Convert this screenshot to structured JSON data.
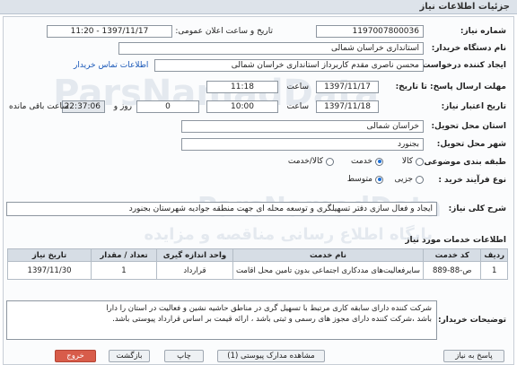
{
  "page_title": "جزئیات اطلاعات نیاز",
  "fields": {
    "need_number_label": "شماره نیاز:",
    "need_number": "1197007800036",
    "announce_label": "تاریخ و ساعت اعلان عمومی:",
    "announce_value": "1397/11/17 - 11:20",
    "buyer_label": "نام دستگاه خریدار:",
    "buyer_value": "استانداری خراسان شمالی",
    "creator_label": "ایجاد کننده درخواست:",
    "creator_value": "محسن ناصری مقدم کاربرداز استانداری خراسان شمالی",
    "contact_link": "اطلاعات تماس خریدار",
    "send_deadline_label": "مهلت ارسال پاسخ: تا تاریخ:",
    "send_date": "1397/11/17",
    "time_label": "ساعت",
    "send_time": "11:18",
    "validity_label": "تاریخ اعتبار نیاز:",
    "validity_date": "1397/11/18",
    "validity_time": "10:00",
    "days_value": "0",
    "days_label": "روز و",
    "remaining_time": "22:37:06",
    "remaining_label": "ساعت باقی مانده",
    "province_label": "استان محل تحویل:",
    "province_value": "خراسان شمالی",
    "city_label": "شهر محل تحویل:",
    "city_value": "بجنورد",
    "category_label": "طبقه بندی موضوعی:",
    "category_options": [
      "کالا",
      "خدمت",
      "کالا/خدمت"
    ],
    "category_selected": "خدمت",
    "process_label": "نوع فرآیند خرید :",
    "process_options": [
      "جزیی",
      "متوسط"
    ],
    "process_selected": "متوسط",
    "description_label": "شرح کلی نیاز:",
    "description_value": "ایجاد و فعال سازی دفتر تسهیلگری و توسعه محله ای جهت منطقه جوادیه شهرستان بجنورد"
  },
  "services_title": "اطلاعات خدمات مورد نیاز",
  "table": {
    "headers": [
      "ردیف",
      "کد خدمت",
      "نام خدمت",
      "واحد اندازه گیری",
      "تعداد / مقدار",
      "تاریخ نیاز"
    ],
    "rows": [
      [
        "1",
        "ص-88-889",
        "سایرفعالیت‌های مددکاری اجتماعی بدون تامین محل اقامت",
        "قرارداد",
        "1",
        "1397/11/30"
      ]
    ]
  },
  "notes_label": "توضیحات خریدار:",
  "notes_line1": "شرکت کننده دارای سابقه کاری مرتبط با تسهیل گری در مناطق حاشیه نشین و فعالیت در استان را دارا",
  "notes_line2": "باشد ،شرکت کننده دارای مجوز های رسمی و ثبتی باشد ، ارائه قیمت بر اساس قرارداد پیوستی باشد.",
  "buttons": {
    "reply": "پاسخ به نیاز",
    "attachments": "مشاهده مدارک پیوستی (1)",
    "print": "چاپ",
    "back": "بازگشت",
    "exit": "خروج"
  },
  "watermark": {
    "line1": "ParsNamadData",
    "line2": "پایگاه اطلاع رسانی مناقصه و مزایده"
  },
  "colors": {
    "header_bg": "#dde3ea",
    "link": "#1a58b8",
    "radio_on": "#1d6fd6",
    "exit_button": "#d85c4a",
    "remaining_bg": "#e3e7ec"
  }
}
